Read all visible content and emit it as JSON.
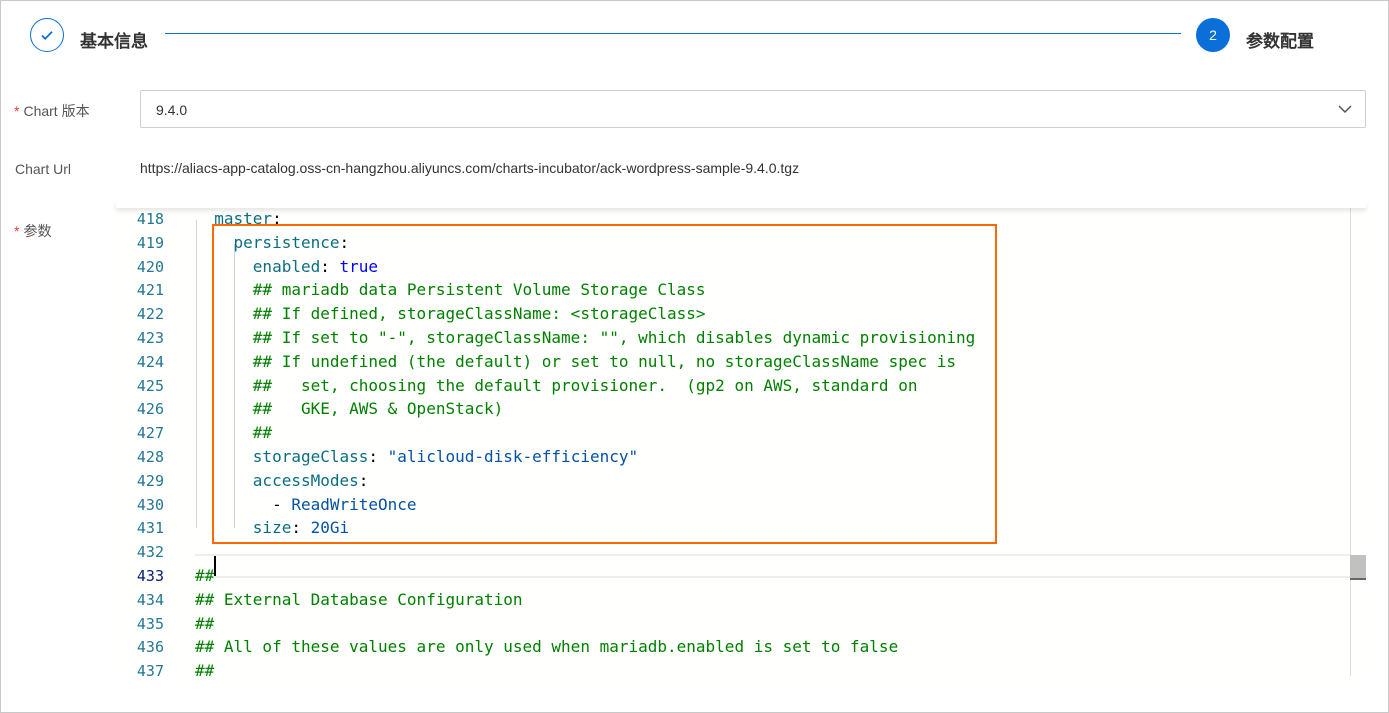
{
  "steps": [
    {
      "label": "基本信息",
      "state": "done",
      "icon": "check-icon"
    },
    {
      "label": "参数配置",
      "number": "2",
      "state": "active"
    }
  ],
  "accent": "#0a6fd8",
  "highlight_color": "#ff6a00",
  "form": {
    "chart_version": {
      "label": "Chart 版本",
      "required": "*",
      "value": "9.4.0"
    },
    "chart_url": {
      "label": "Chart Url",
      "value": "https://aliacs-app-catalog.oss-cn-hangzhou.aliyuncs.com/charts-incubator/ack-wordpress-sample-9.4.0.tgz"
    },
    "params": {
      "label": "参数",
      "required": "*"
    }
  },
  "editor": {
    "current_line": "433",
    "lines": [
      {
        "n": "418",
        "text": "  master:"
      },
      {
        "n": "419",
        "text": "    persistence:"
      },
      {
        "n": "420",
        "text": "      enabled: true"
      },
      {
        "n": "421",
        "text": "      ## mariadb data Persistent Volume Storage Class"
      },
      {
        "n": "422",
        "text": "      ## If defined, storageClassName: <storageClass>"
      },
      {
        "n": "423",
        "text": "      ## If set to \"-\", storageClassName: \"\", which disables dynamic provisioning"
      },
      {
        "n": "424",
        "text": "      ## If undefined (the default) or set to null, no storageClassName spec is"
      },
      {
        "n": "425",
        "text": "      ##   set, choosing the default provisioner.  (gp2 on AWS, standard on"
      },
      {
        "n": "426",
        "text": "      ##   GKE, AWS & OpenStack)"
      },
      {
        "n": "427",
        "text": "      ##"
      },
      {
        "n": "428",
        "text": "      storageClass: \"alicloud-disk-efficiency\""
      },
      {
        "n": "429",
        "text": "      accessModes:"
      },
      {
        "n": "430",
        "text": "        - ReadWriteOnce"
      },
      {
        "n": "431",
        "text": "      size: 20Gi"
      },
      {
        "n": "432",
        "text": ""
      },
      {
        "n": "433",
        "text": "##"
      },
      {
        "n": "434",
        "text": "## External Database Configuration"
      },
      {
        "n": "435",
        "text": "##"
      },
      {
        "n": "436",
        "text": "## All of these values are only used when mariadb.enabled is set to false"
      },
      {
        "n": "437",
        "text": "##"
      }
    ]
  }
}
